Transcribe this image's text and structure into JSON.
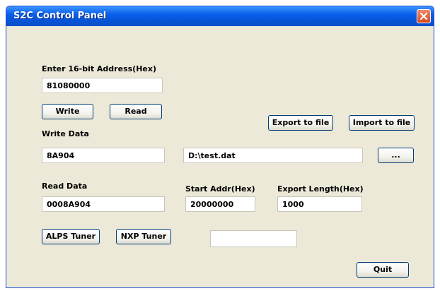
{
  "window": {
    "title": "S2C Control Panel"
  },
  "address": {
    "label": "Enter 16-bit Address(Hex)",
    "value": "81080000"
  },
  "buttons": {
    "write": "Write",
    "read": "Read",
    "export": "Export to file",
    "import": "Import to file",
    "browse": "...",
    "alps": "ALPS Tuner",
    "nxp": "NXP Tuner",
    "quit": "Quit"
  },
  "write_data": {
    "label": "Write Data",
    "value": "8A904"
  },
  "file_path": {
    "value": "D:\\test.dat"
  },
  "read_data": {
    "label": "Read Data",
    "value": "0008A904"
  },
  "start_addr": {
    "label": "Start Addr(Hex)",
    "value": "20000000"
  },
  "export_length": {
    "label": "Export Length(Hex)",
    "value": "1000"
  },
  "status_box": {
    "value": ""
  },
  "icons": {
    "close": "close-icon"
  }
}
